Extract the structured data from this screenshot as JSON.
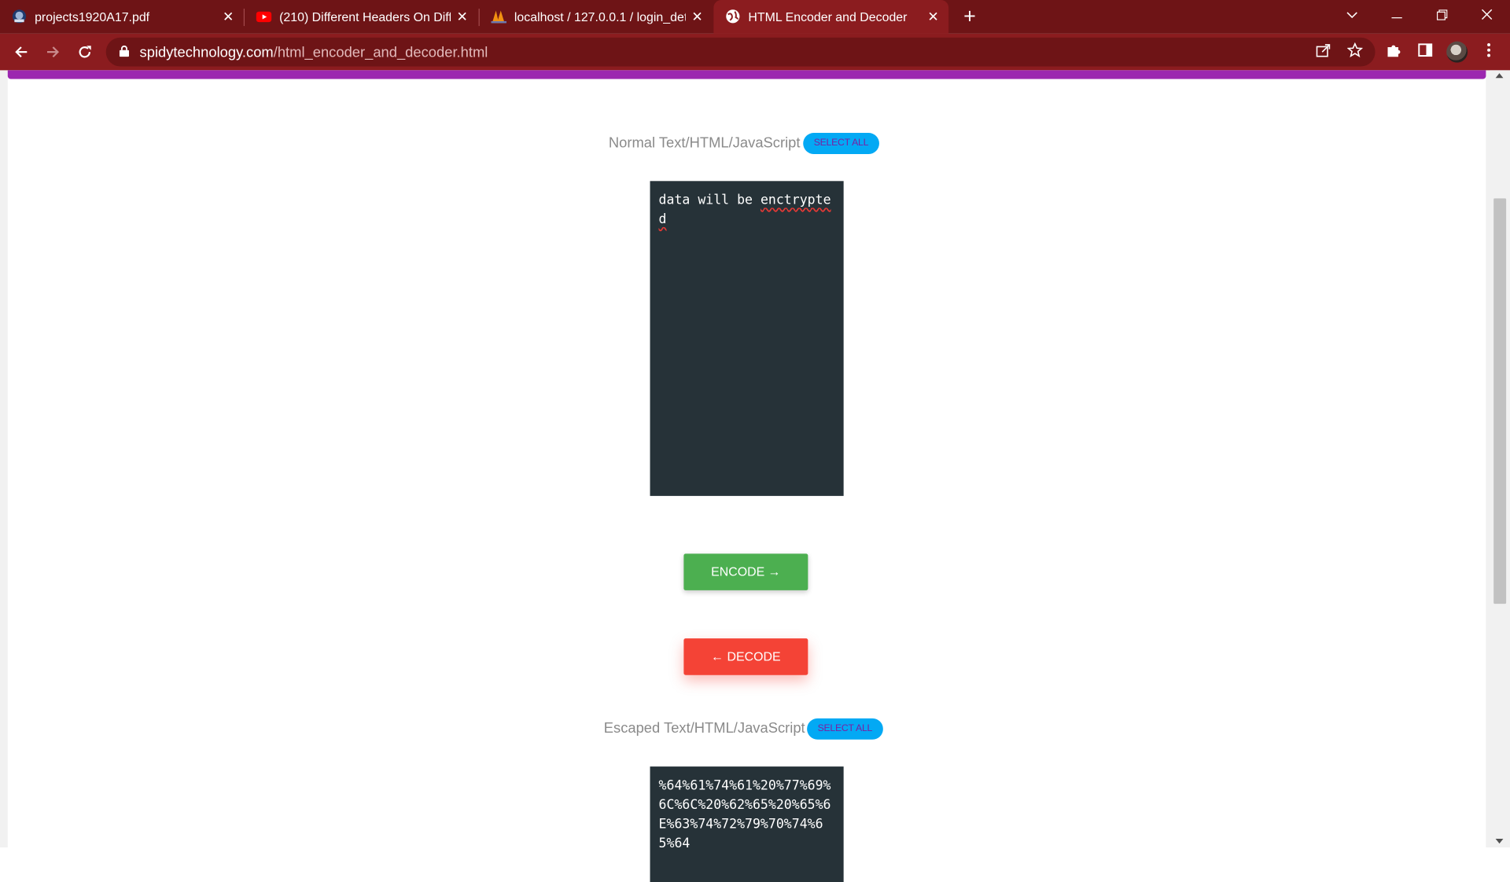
{
  "browser": {
    "tabs": [
      {
        "title": "projects1920A17.pdf",
        "icon": "pdf-app-icon",
        "active": false
      },
      {
        "title": "(210) Different Headers On Differ",
        "icon": "youtube-icon",
        "active": false
      },
      {
        "title": "localhost / 127.0.0.1 / login_detai",
        "icon": "phpmyadmin-icon",
        "active": false
      },
      {
        "title": "HTML Encoder and Decoder",
        "icon": "globe-icon",
        "active": true
      }
    ],
    "url_host": "spidytechnology.com",
    "url_path": "/html_encoder_and_decoder.html",
    "theme_color": "#8b1c1f",
    "tabstrip_color": "#6e1416"
  },
  "page": {
    "accent_bar_color": "#9c27b0",
    "input_section": {
      "label": "Normal Text/HTML/JavaScript",
      "select_all_label": "SELECT ALL",
      "text_before": "data will be ",
      "text_misspelled": "enctrypted"
    },
    "encode_label": "ENCODE →",
    "decode_label": "← DECODE",
    "output_section": {
      "label": "Escaped Text/HTML/JavaScript",
      "select_all_label": "SELECT ALL",
      "text": "%64%61%74%61%20%77%69%6C%6C%20%62%65%20%65%6E%63%74%72%79%70%74%65%64"
    },
    "colors": {
      "encode": "#4caf50",
      "decode": "#f44336",
      "select_all": "#03a9f4",
      "code_bg": "#263238"
    }
  }
}
